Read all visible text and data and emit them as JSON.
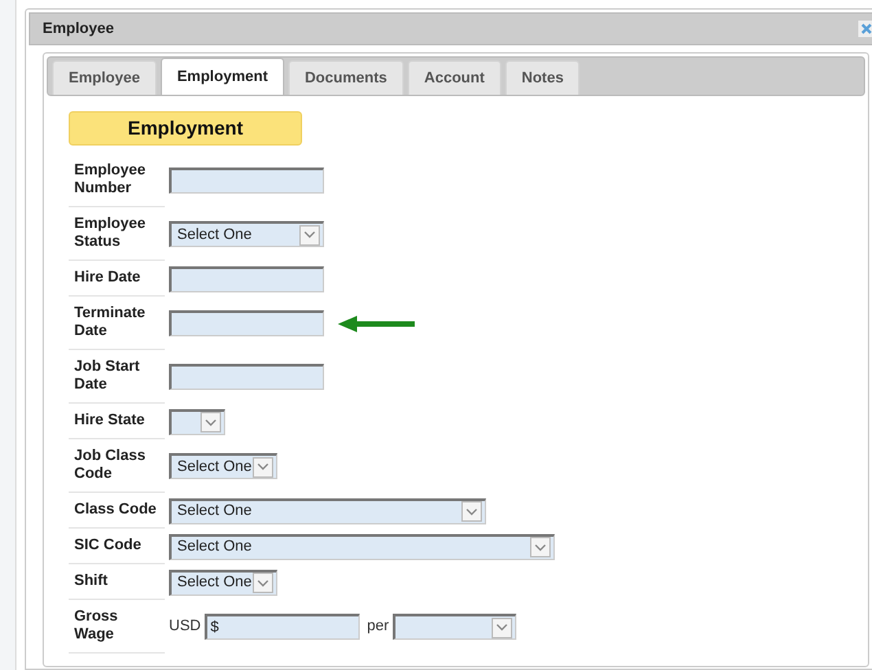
{
  "window": {
    "title": "Employee"
  },
  "tabs": [
    {
      "label": "Employee",
      "selected": false
    },
    {
      "label": "Employment",
      "selected": true
    },
    {
      "label": "Documents",
      "selected": false
    },
    {
      "label": "Account",
      "selected": false
    },
    {
      "label": "Notes",
      "selected": false
    }
  ],
  "section_title": "Employment",
  "rows": [
    {
      "label": "Employee Number",
      "kind": "text",
      "pointer": false
    },
    {
      "label": "Employee Status",
      "kind": "select",
      "value": "Select One",
      "pointer": false
    },
    {
      "label": "Hire Date",
      "kind": "text",
      "pointer": false
    },
    {
      "label": "Terminate Date",
      "kind": "text",
      "pointer": true
    },
    {
      "label": "Job Start Date",
      "kind": "text",
      "pointer": false
    },
    {
      "label": "Hire State",
      "kind": "select",
      "pointer": false
    },
    {
      "label": "Job Class Code",
      "kind": "select",
      "value": "Select One",
      "pointer": false
    },
    {
      "label": "Class Code",
      "kind": "select",
      "value": "Select One",
      "pointer": false
    },
    {
      "label": "SIC Code",
      "kind": "select",
      "value": "Select One",
      "pointer": false
    },
    {
      "label": "Shift",
      "kind": "select",
      "value": "Select One",
      "pointer": false
    },
    {
      "label": "Gross Wage",
      "kind": "wage",
      "currency": "USD",
      "value": "$",
      "per": "per",
      "pointer": false
    }
  ]
}
